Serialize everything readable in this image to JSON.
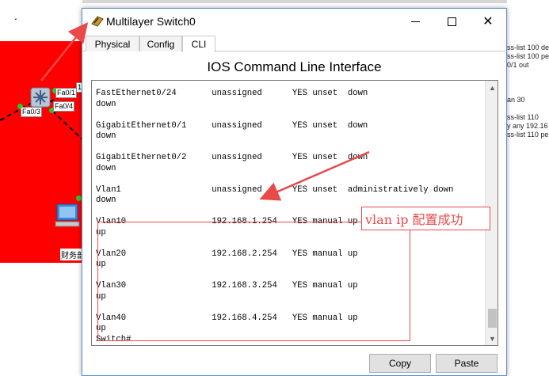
{
  "background": {
    "ports": [
      "Fa0/1",
      "Fa0/3",
      "Fa0/4",
      "1"
    ],
    "pc_label": "财务部",
    "right_snippets": [
      "ss-list 100 de",
      "ss-list 100 pe",
      "0/1 out",
      "an 30",
      "ss-list 110",
      "y any 192.16",
      "ss-list 110 pe"
    ],
    "dot": "."
  },
  "window": {
    "title": "Multilayer Switch0",
    "title_icon": "switch-icon",
    "controls": {
      "minimize": "minimize-icon",
      "maximize": "maximize-icon",
      "close": "✕"
    },
    "tabs": [
      {
        "label": "Physical",
        "active": false
      },
      {
        "label": "Config",
        "active": false
      },
      {
        "label": "CLI",
        "active": true
      }
    ],
    "heading": "IOS Command Line Interface",
    "terminal_lines": [
      "FastEthernet0/24       unassigned      YES unset  down",
      "down",
      "",
      "GigabitEthernet0/1     unassigned      YES unset  down",
      "down",
      "",
      "GigabitEthernet0/2     unassigned      YES unset  down",
      "down",
      "",
      "Vlan1                  unassigned      YES unset  administratively down",
      "down",
      "",
      "Vlan10                 192.168.1.254   YES manual up",
      "up",
      "",
      "Vlan20                 192.168.2.254   YES manual up",
      "up",
      "",
      "Vlan30                 192.168.3.254   YES manual up",
      "up",
      "",
      "Vlan40                 192.168.4.254   YES manual up",
      "up",
      "Switch#"
    ],
    "annotation": "vlan ip 配置成功",
    "buttons": {
      "copy": "Copy",
      "paste": "Paste"
    },
    "annotation_color": "#e84a4a",
    "window_border_color": "#5a8fd0"
  }
}
